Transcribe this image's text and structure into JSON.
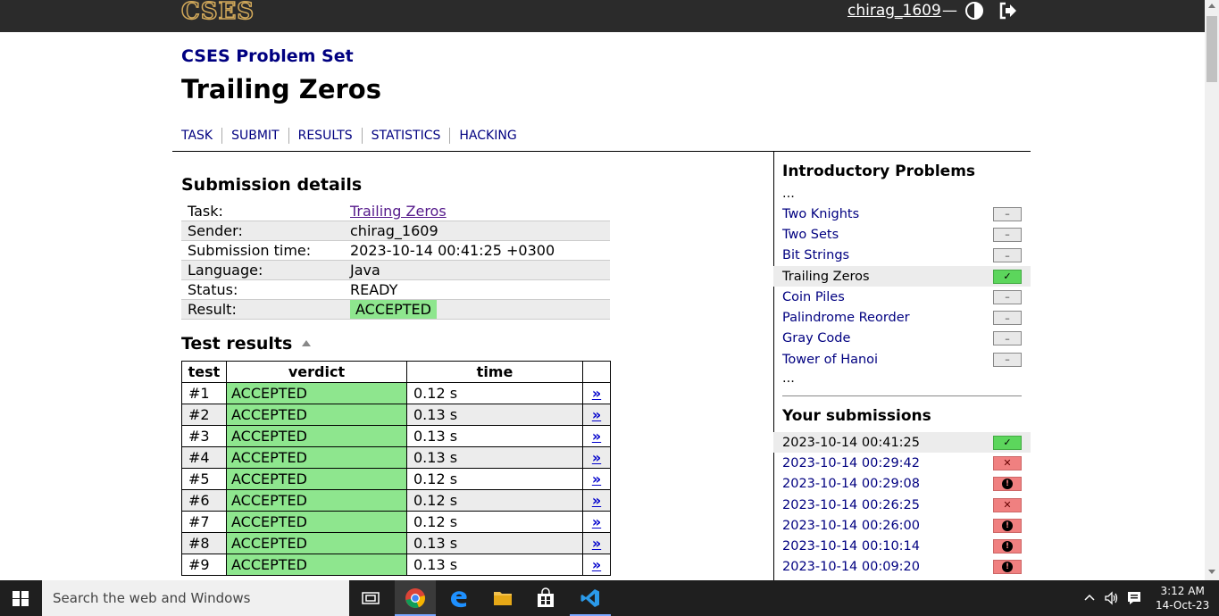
{
  "header": {
    "logo": "CSES",
    "username": "chirag_1609",
    "dash": "—"
  },
  "breadcrumb": "CSES Problem Set",
  "title": "Trailing Zeros",
  "tabs": [
    "TASK",
    "SUBMIT",
    "RESULTS",
    "STATISTICS",
    "HACKING"
  ],
  "details": {
    "heading": "Submission details",
    "rows": [
      {
        "label": "Task:",
        "value": "Trailing Zeros"
      },
      {
        "label": "Sender:",
        "value": "chirag_1609"
      },
      {
        "label": "Submission time:",
        "value": "2023-10-14 00:41:25 +0300"
      },
      {
        "label": "Language:",
        "value": "Java"
      },
      {
        "label": "Status:",
        "value": "READY"
      },
      {
        "label": "Result:",
        "value": "ACCEPTED"
      }
    ]
  },
  "tests": {
    "heading": "Test results",
    "columns": [
      "test",
      "verdict",
      "time"
    ],
    "link_text": "»",
    "rows": [
      {
        "test": "#1",
        "verdict": "ACCEPTED",
        "time": "0.12 s"
      },
      {
        "test": "#2",
        "verdict": "ACCEPTED",
        "time": "0.13 s"
      },
      {
        "test": "#3",
        "verdict": "ACCEPTED",
        "time": "0.13 s"
      },
      {
        "test": "#4",
        "verdict": "ACCEPTED",
        "time": "0.13 s"
      },
      {
        "test": "#5",
        "verdict": "ACCEPTED",
        "time": "0.12 s"
      },
      {
        "test": "#6",
        "verdict": "ACCEPTED",
        "time": "0.12 s"
      },
      {
        "test": "#7",
        "verdict": "ACCEPTED",
        "time": "0.12 s"
      },
      {
        "test": "#8",
        "verdict": "ACCEPTED",
        "time": "0.13 s"
      },
      {
        "test": "#9",
        "verdict": "ACCEPTED",
        "time": "0.13 s"
      }
    ]
  },
  "sidebar": {
    "heading": "Introductory Problems",
    "ellipsis": "...",
    "problems": [
      {
        "name": "Two Knights",
        "status": "–"
      },
      {
        "name": "Two Sets",
        "status": "–"
      },
      {
        "name": "Bit Strings",
        "status": "–"
      },
      {
        "name": "Trailing Zeros",
        "status": "✓"
      },
      {
        "name": "Coin Piles",
        "status": "–"
      },
      {
        "name": "Palindrome Reorder",
        "status": "–"
      },
      {
        "name": "Gray Code",
        "status": "–"
      },
      {
        "name": "Tower of Hanoi",
        "status": "–"
      }
    ],
    "subs_heading": "Your submissions",
    "submissions": [
      {
        "time": "2023-10-14 00:41:25",
        "status": "✓"
      },
      {
        "time": "2023-10-14 00:29:42",
        "status": "✕"
      },
      {
        "time": "2023-10-14 00:29:08",
        "status": "!"
      },
      {
        "time": "2023-10-14 00:26:25",
        "status": "✕"
      },
      {
        "time": "2023-10-14 00:26:00",
        "status": "!"
      },
      {
        "time": "2023-10-14 00:10:14",
        "status": "!"
      },
      {
        "time": "2023-10-14 00:09:20",
        "status": "!"
      }
    ]
  },
  "taskbar": {
    "search_placeholder": "Search the web and Windows",
    "time": "3:12 AM",
    "date": "14-Oct-23"
  }
}
